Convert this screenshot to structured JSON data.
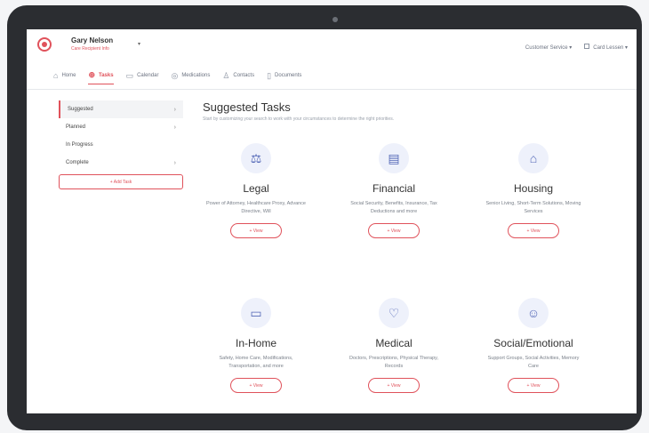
{
  "header": {
    "user_name": "Gary Nelson",
    "user_sub": "Care Recipient Info",
    "right_items": [
      "Customer Service",
      "Card Lessen"
    ]
  },
  "nav": {
    "tabs": [
      {
        "label": "Home",
        "icon": "home-icon",
        "active": false
      },
      {
        "label": "Tasks",
        "icon": "tasks-icon",
        "active": true
      },
      {
        "label": "Calendar",
        "icon": "calendar-icon",
        "active": false
      },
      {
        "label": "Medications",
        "icon": "pills-icon",
        "active": false
      },
      {
        "label": "Contacts",
        "icon": "person-icon",
        "active": false
      },
      {
        "label": "Documents",
        "icon": "document-icon",
        "active": false
      }
    ]
  },
  "sidebar": {
    "items": [
      {
        "label": "Suggested",
        "active": true
      },
      {
        "label": "Planned",
        "active": false
      },
      {
        "label": "In Progress",
        "active": false
      },
      {
        "label": "Complete",
        "active": false
      }
    ],
    "button_label": "+ Add Task"
  },
  "main": {
    "title": "Suggested Tasks",
    "subtitle": "Start by customizing your search to work with your circumstances to determine the right priorities.",
    "cards": [
      {
        "title": "Legal",
        "desc": "Power of Attorney, Healthcare Proxy, Advance Directive, Will",
        "button": "+ View",
        "icon": "scales-icon"
      },
      {
        "title": "Financial",
        "desc": "Social Security, Benefits, Insurance, Tax Deductions and more",
        "button": "+ View",
        "icon": "money-icon"
      },
      {
        "title": "Housing",
        "desc": "Senior Living, Short-Term Solutions, Moving Services",
        "button": "+ View",
        "icon": "house-icon"
      },
      {
        "title": "In-Home",
        "desc": "Safety, Home Care, Modifications, Transportation, and more",
        "button": "+ View",
        "icon": "bed-icon"
      },
      {
        "title": "Medical",
        "desc": "Doctors, Prescriptions, Physical Therapy, Records",
        "button": "+ View",
        "icon": "heart-pulse-icon"
      },
      {
        "title": "Social/Emotional",
        "desc": "Support Groups, Social Activities, Memory Care",
        "button": "+ View",
        "icon": "social-icon"
      }
    ]
  }
}
